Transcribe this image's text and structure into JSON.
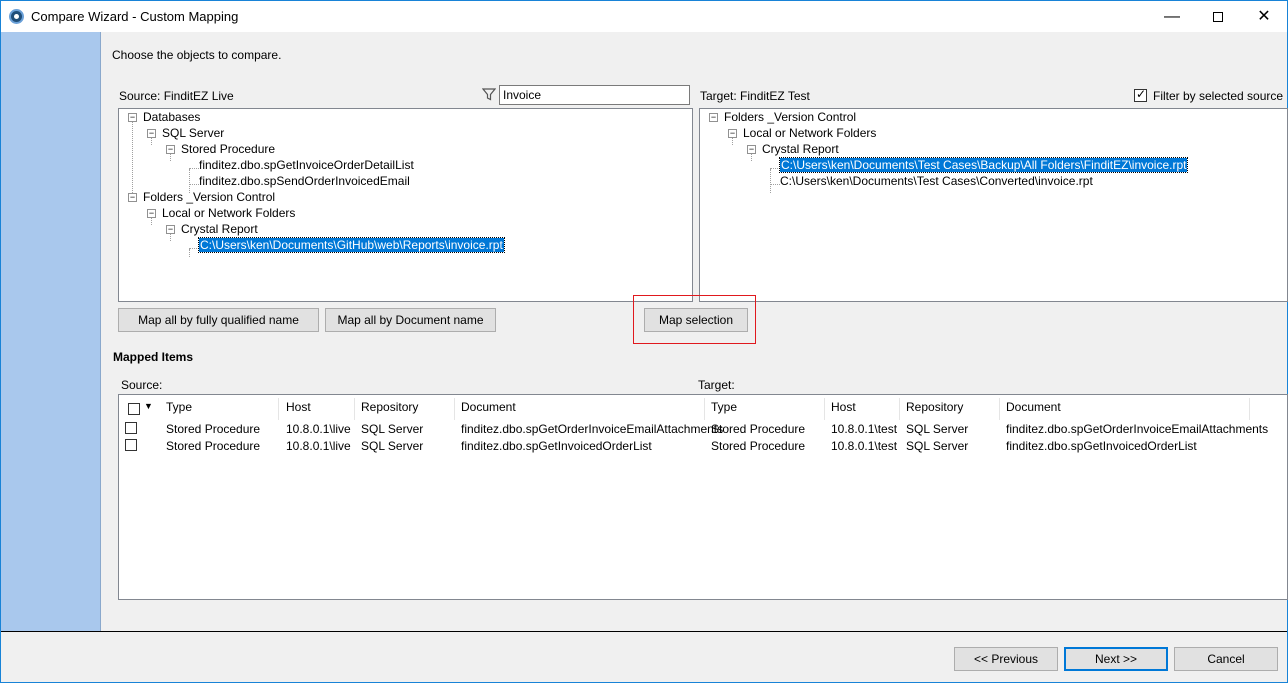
{
  "window": {
    "title": "Compare Wizard - Custom Mapping",
    "minimize_glyph": "—",
    "close_glyph": "✕"
  },
  "instructions": "Choose the objects to compare.",
  "source": {
    "label": "Source: FinditEZ Live",
    "filter_value": "Invoice",
    "tree": [
      {
        "label": "Databases",
        "level": 0,
        "expanded": true
      },
      {
        "label": "SQL Server",
        "level": 1,
        "expanded": true
      },
      {
        "label": "Stored Procedure",
        "level": 2,
        "expanded": true
      },
      {
        "label": "finditez.dbo.spGetInvoiceOrderDetailList",
        "level": 3,
        "leaf": true
      },
      {
        "label": "finditez.dbo.spSendOrderInvoicedEmail",
        "level": 3,
        "leaf": true
      },
      {
        "label": "Folders _Version Control",
        "level": 0,
        "expanded": true
      },
      {
        "label": "Local or Network Folders",
        "level": 1,
        "expanded": true
      },
      {
        "label": "Crystal Report",
        "level": 2,
        "expanded": true
      },
      {
        "label": "C:\\Users\\ken\\Documents\\GitHub\\web\\Reports\\invoice.rpt",
        "level": 3,
        "leaf": true,
        "selected": true
      }
    ]
  },
  "target": {
    "label": "Target: FinditEZ Test",
    "filter_by_source_label": "Filter by selected source",
    "filter_by_source_checked": true,
    "tree": [
      {
        "label": "Folders _Version Control",
        "level": 0,
        "expanded": true
      },
      {
        "label": "Local or Network Folders",
        "level": 1,
        "expanded": true
      },
      {
        "label": "Crystal Report",
        "level": 2,
        "expanded": true
      },
      {
        "label": "C:\\Users\\ken\\Documents\\Test Cases\\Backup\\All Folders\\FinditEZ\\invoice.rpt",
        "level": 3,
        "leaf": true,
        "selected": true
      },
      {
        "label": "C:\\Users\\ken\\Documents\\Test Cases\\Converted\\invoice.rpt",
        "level": 3,
        "leaf": true
      }
    ]
  },
  "buttons": {
    "map_fqn": "Map all by fully qualified name",
    "map_doc": "Map all by Document name",
    "map_selection": "Map selection",
    "previous": "<< Previous",
    "next": "Next >>",
    "cancel": "Cancel"
  },
  "mapped": {
    "title": "Mapped Items",
    "source_label": "Source:",
    "target_label": "Target:",
    "header_dropdown_glyph": "▼",
    "columns": [
      "Type",
      "Host",
      "Repository",
      "Document",
      "Type",
      "Host",
      "Repository",
      "Document"
    ],
    "rows": [
      [
        "Stored Procedure",
        "10.8.0.1\\live",
        "SQL Server",
        "finditez.dbo.spGetOrderInvoiceEmailAttachments",
        "Stored Procedure",
        "10.8.0.1\\test",
        "SQL Server",
        "finditez.dbo.spGetOrderInvoiceEmailAttachments"
      ],
      [
        "Stored Procedure",
        "10.8.0.1\\live",
        "SQL Server",
        "finditez.dbo.spGetInvoicedOrderList",
        "Stored Procedure",
        "10.8.0.1\\test",
        "SQL Server",
        "finditez.dbo.spGetInvoicedOrderList"
      ]
    ]
  }
}
